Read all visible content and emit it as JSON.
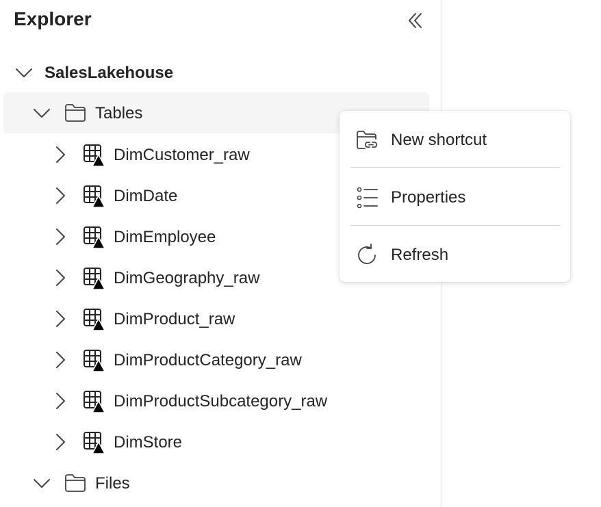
{
  "explorer": {
    "title": "Explorer",
    "lakehouse": "SalesLakehouse",
    "tables_folder": "Tables",
    "files_folder": "Files",
    "tables": [
      "DimCustomer_raw",
      "DimDate",
      "DimEmployee",
      "DimGeography_raw",
      "DimProduct_raw",
      "DimProductCategory_raw",
      "DimProductSubcategory_raw",
      "DimStore"
    ]
  },
  "context_menu": {
    "items": [
      {
        "label": "New shortcut",
        "icon": "folder-link-icon"
      },
      {
        "label": "Properties",
        "icon": "properties-list-icon"
      },
      {
        "label": "Refresh",
        "icon": "refresh-icon"
      }
    ]
  }
}
